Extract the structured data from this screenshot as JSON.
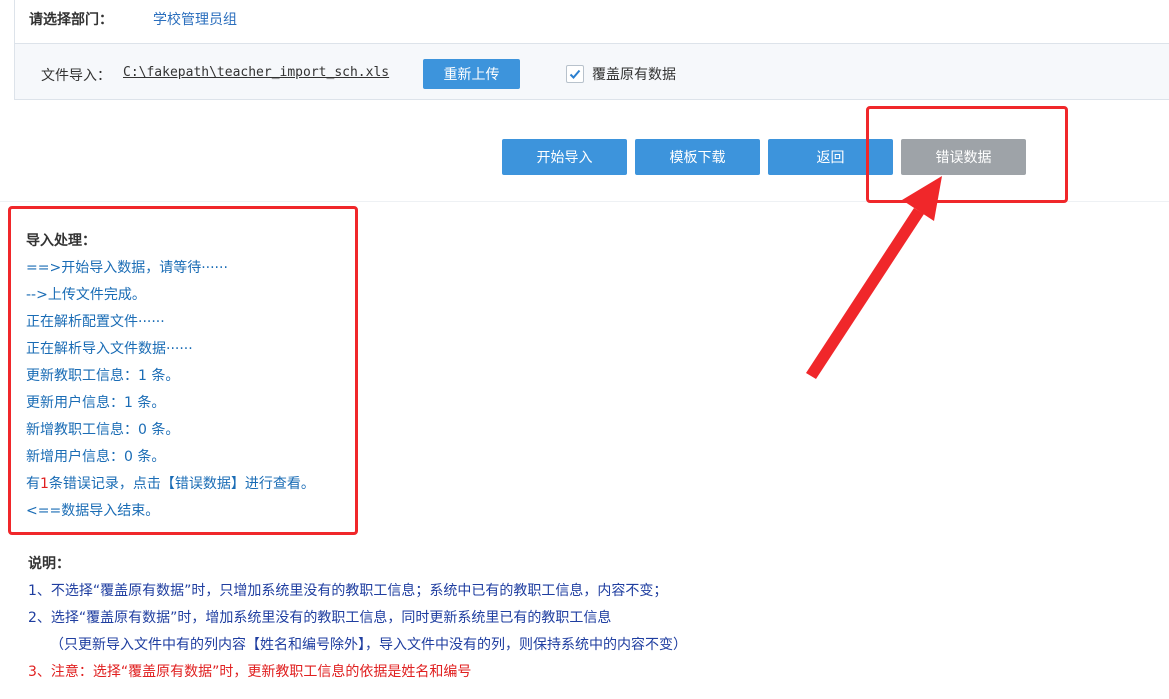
{
  "department": {
    "label": "请选择部门：",
    "value": "学校管理员组"
  },
  "file_import": {
    "label": "文件导入：",
    "path": "C:\\fakepath\\teacher_import_sch.xls",
    "reupload_label": "重新上传",
    "overwrite_label": "覆盖原有数据",
    "overwrite_checked": true
  },
  "actions": {
    "start_label": "开始导入",
    "template_label": "模板下载",
    "back_label": "返回",
    "error_label": "错误数据"
  },
  "log": {
    "title": "导入处理：",
    "lines": [
      "==>开始导入数据，请等待······",
      "-->上传文件完成。",
      "正在解析配置文件······",
      "正在解析导入文件数据······",
      "更新教职工信息：1 条。",
      "更新用户信息：1 条。",
      "新增教职工信息：0 条。",
      "新增用户信息：0 条。"
    ],
    "error_prefix": "有",
    "error_count": "1",
    "error_suffix": "条错误记录，点击【错误数据】进行查看。",
    "end_line": "<==数据导入结束。"
  },
  "notes": {
    "title": "说明：",
    "items": [
      "1、不选择“覆盖原有数据”时，只增加系统里没有的教职工信息；系统中已有的教职工信息，内容不变；",
      "2、选择“覆盖原有数据”时，增加系统里没有的教职工信息，同时更新系统里已有的教职工信息",
      "（只更新导入文件中有的列内容【姓名和编号除外】，导入文件中没有的列，则保持系统中的内容不变）",
      "3、注意：选择“覆盖原有数据”时，更新教职工信息的依据是姓名和编号"
    ]
  },
  "colors": {
    "primary_button": "#3d94dc",
    "disabled_button": "#9ea3a8",
    "log_text": "#1a6cb5",
    "highlight": "#f0272a"
  }
}
